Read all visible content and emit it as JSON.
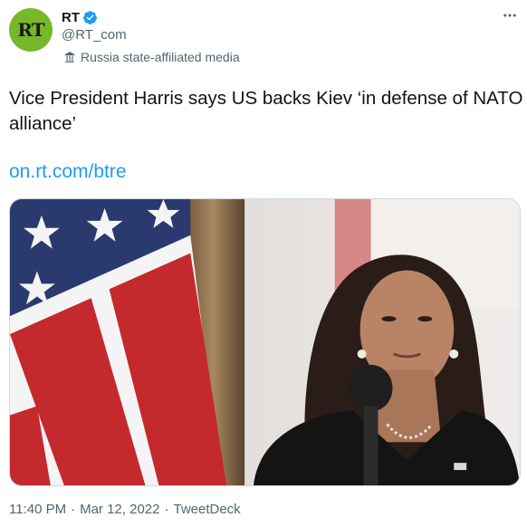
{
  "author": {
    "avatar_text": "RT",
    "display_name": "RT",
    "handle": "@RT_com",
    "label": "Russia state-affiliated media"
  },
  "tweet": {
    "text": "Vice President Harris says US backs Kiev ‘in defense of NATO alliance’",
    "link": "on.rt.com/btre"
  },
  "meta": {
    "time": "11:40 PM",
    "separator": "·",
    "date": "Mar 12, 2022",
    "source": "TweetDeck"
  },
  "colors": {
    "avatar_bg": "#77b82a",
    "verified": "#1d9bf0",
    "link": "#1d9bf0",
    "secondary_text": "#536471"
  },
  "icons": {
    "more": "more-horizontal-icon",
    "verified": "verified-badge-icon",
    "label": "state-media-icon"
  }
}
